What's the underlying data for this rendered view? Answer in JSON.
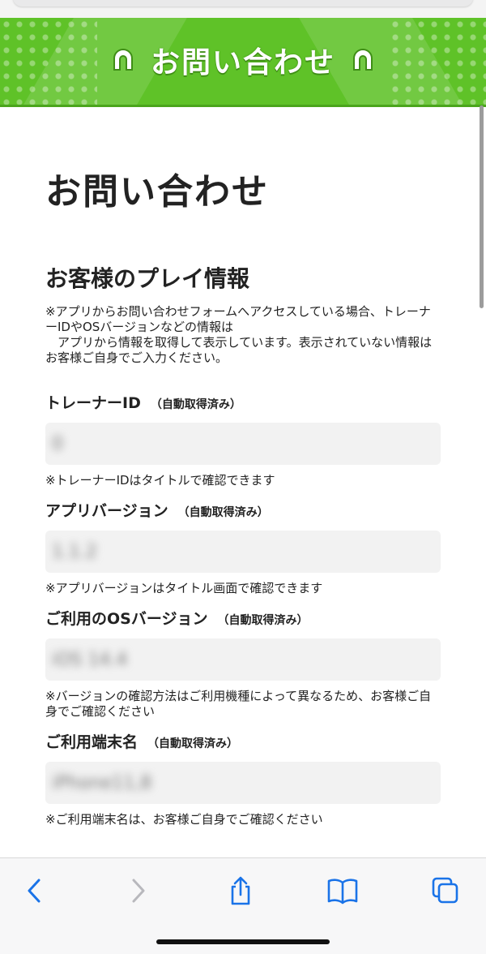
{
  "banner": {
    "title": "お問い合わせ"
  },
  "page": {
    "title": "お問い合わせ",
    "section_title": "お客様のプレイ情報",
    "notice": "※アプリからお問い合わせフォームへアクセスしている場合、トレーナーIDやOSバージョンなどの情報は\n　アプリから情報を取得して表示しています。表示されていない情報はお客様ご自身でご入力ください。"
  },
  "fields": [
    {
      "label": "トレーナーID",
      "auto": "（自動取得済み）",
      "value": "0",
      "note": "※トレーナーIDはタイトルで確認できます"
    },
    {
      "label": "アプリバージョン",
      "auto": "（自動取得済み）",
      "value": "1.1.2",
      "note": "※アプリバージョンはタイトル画面で確認できます"
    },
    {
      "label": "ご利用のOSバージョン",
      "auto": "（自動取得済み）",
      "value": "iOS 14.4",
      "note": "※バージョンの確認方法はご利用機種によって異なるため、お客様ご自身でご確認ください"
    },
    {
      "label": "ご利用端末名",
      "auto": "（自動取得済み）",
      "value": "iPhone11,8",
      "note": "※ご利用端末名は、お客様ご自身でご確認ください"
    }
  ],
  "toolbar": {
    "back_icon": "chevron-left-icon",
    "forward_icon": "chevron-right-icon",
    "share_icon": "share-icon",
    "bookmarks_icon": "book-icon",
    "tabs_icon": "tabs-icon",
    "accent_color": "#1a73e8"
  },
  "colors": {
    "banner_green": "#5fc228",
    "field_bg": "#f2f2f2"
  }
}
